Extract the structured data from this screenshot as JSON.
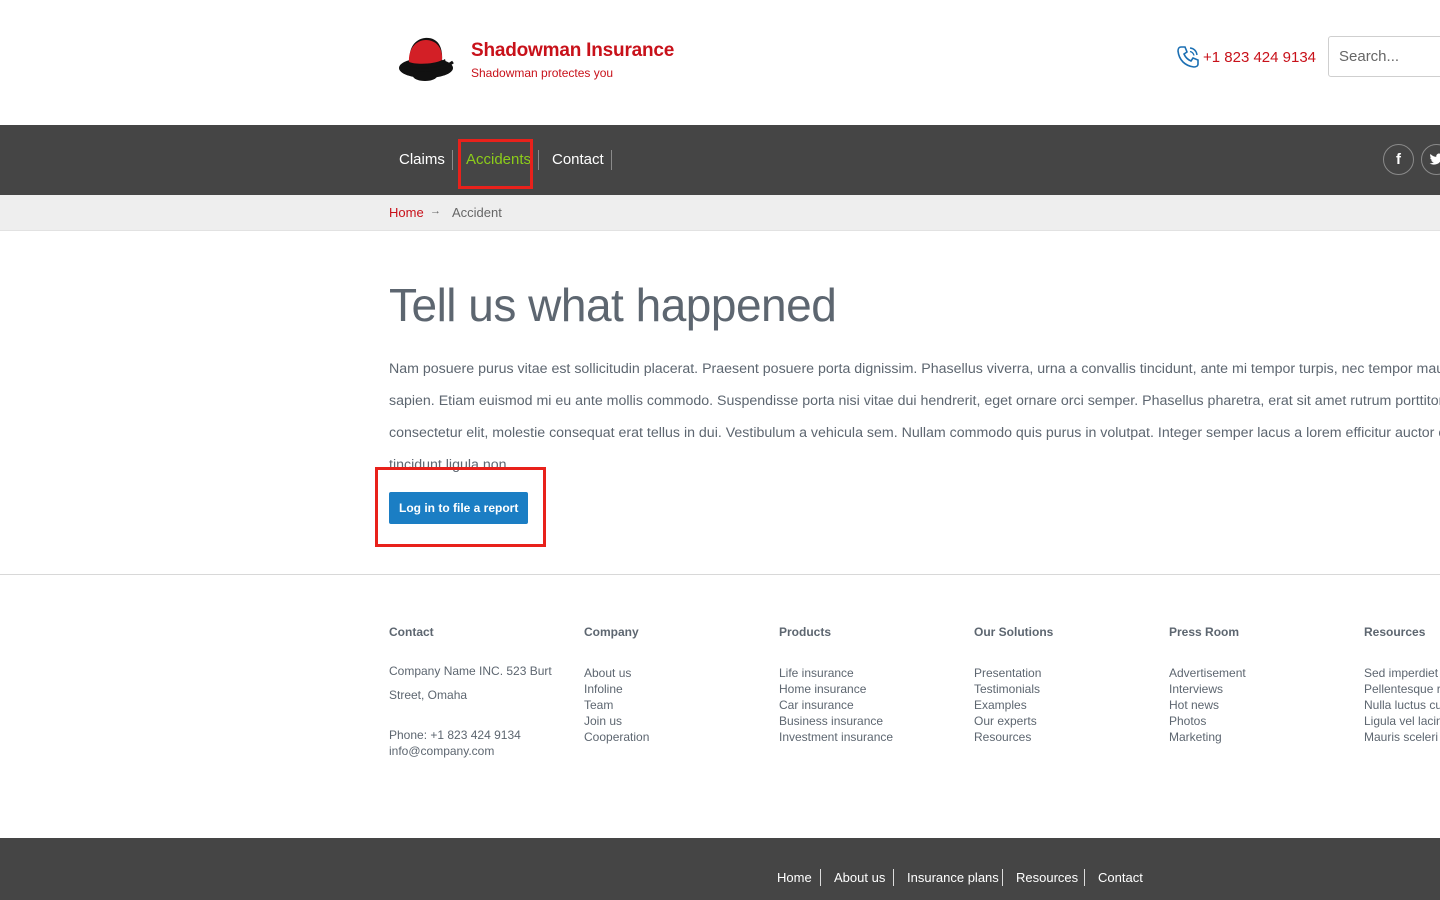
{
  "brand": {
    "name": "Shadowman Insurance",
    "tagline": "Shadowman protectes you"
  },
  "header": {
    "phone": "+1 823 424 9134",
    "search_placeholder": "Search..."
  },
  "nav": {
    "items": [
      {
        "label": "Claims",
        "active": false
      },
      {
        "label": "Accidents",
        "active": true
      },
      {
        "label": "Contact",
        "active": false
      }
    ],
    "social": [
      "facebook-icon",
      "twitter-icon"
    ]
  },
  "breadcrumb": {
    "home": "Home",
    "arrow": "→",
    "current": "Accident"
  },
  "main": {
    "title": "Tell us what happened",
    "body": "Nam posuere purus vitae est sollicitudin placerat. Praesent posuere porta dignissim. Phasellus viverra, urna a convallis tincidunt, ante mi tempor turpis, nec tempor mauris sapien. Etiam euismod mi eu ante mollis commodo. Suspendisse porta nisi vitae dui hendrerit, eget ornare orci semper. Phasellus pharetra, erat sit amet rutrum porttitor, est consectetur elit, molestie consequat erat tellus in dui. Vestibulum a vehicula sem. Nullam commodo quis purus in volutpat. Integer semper lacus a lorem efficitur auctor cu tincidunt ligula non.",
    "cta_label": "Log in to file a report"
  },
  "footer": {
    "contact": {
      "heading": "Contact",
      "address": "Company Name INC. 523 Burt Street, Omaha",
      "phone": "Phone: +1 823 424 9134",
      "email": "info@company.com"
    },
    "company": {
      "heading": "Company",
      "links": [
        "About us",
        "Infoline",
        "Team",
        "Join us",
        "Cooperation"
      ]
    },
    "products": {
      "heading": "Products",
      "links": [
        "Life insurance",
        "Home insurance",
        "Car insurance",
        "Business insurance",
        "Investment insurance"
      ]
    },
    "solutions": {
      "heading": "Our Solutions",
      "links": [
        "Presentation",
        "Testimonials",
        "Examples",
        "Our experts",
        "Resources"
      ]
    },
    "press": {
      "heading": "Press Room",
      "links": [
        "Advertisement",
        "Interviews",
        "Hot news",
        "Photos",
        "Marketing"
      ]
    },
    "resources": {
      "heading": "Resources",
      "links": [
        "Sed imperdiet",
        "Pellentesque r",
        "Nulla luctus cu",
        "Ligula vel lacin",
        "Mauris sceleri"
      ]
    }
  },
  "bottom_links": [
    "Home",
    "About us",
    "Insurance plans",
    "Resources",
    "Contact"
  ],
  "colors": {
    "brand_red": "#c8111a",
    "nav_bg": "#454545",
    "active_green": "#8ccc1a",
    "button_blue": "#1b7ec4",
    "highlight_red": "#e8211b"
  }
}
